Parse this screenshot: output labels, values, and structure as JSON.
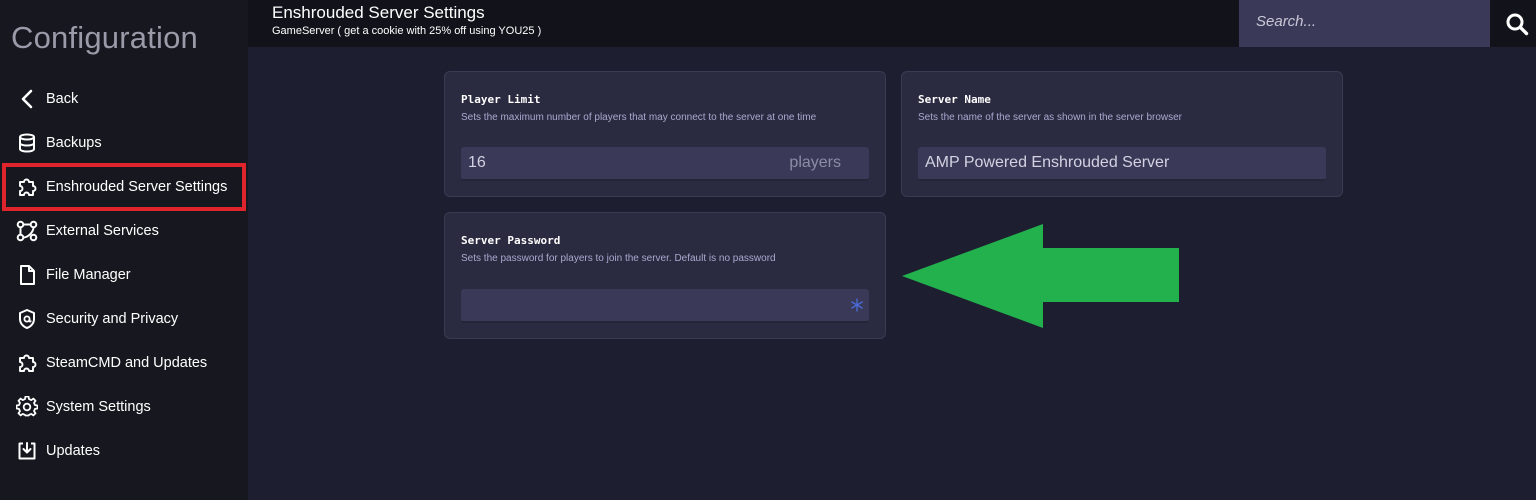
{
  "sidebar": {
    "title": "Configuration",
    "items": [
      {
        "label": "Back",
        "icon": "chevron-left-icon"
      },
      {
        "label": "Backups",
        "icon": "database-icon"
      },
      {
        "label": "Enshrouded Server Settings",
        "icon": "puzzle-icon"
      },
      {
        "label": "External Services",
        "icon": "git-branch-icon"
      },
      {
        "label": "File Manager",
        "icon": "file-icon"
      },
      {
        "label": "Security and Privacy",
        "icon": "shield-icon"
      },
      {
        "label": "SteamCMD and Updates",
        "icon": "puzzle-icon"
      },
      {
        "label": "System Settings",
        "icon": "gear-icon"
      },
      {
        "label": "Updates",
        "icon": "download-box-icon"
      }
    ],
    "selected": "Enshrouded Server Settings"
  },
  "header": {
    "title": "Enshrouded Server Settings",
    "subtitle": "GameServer ( get a cookie with 25% off using YOU25 )",
    "search_placeholder": "Search..."
  },
  "settings": {
    "player_limit": {
      "title": "Player Limit",
      "description": "Sets the maximum number of players that may connect to the server at one time",
      "value": "16",
      "unit": "players"
    },
    "server_name": {
      "title": "Server Name",
      "description": "Sets the name of the server as shown in the server browser",
      "value": "AMP Powered Enshrouded Server"
    },
    "server_password": {
      "title": "Server Password",
      "description": "Sets the password for players to join the server. Default is no password",
      "value": ""
    }
  },
  "colors": {
    "highlight_box": "#e0242b",
    "annotation_arrow": "#22b14c",
    "sidebar_bg": "#17171f",
    "main_bg": "#1e1e31",
    "card_bg": "#2a2a40",
    "field_bg": "#3a3a58"
  }
}
